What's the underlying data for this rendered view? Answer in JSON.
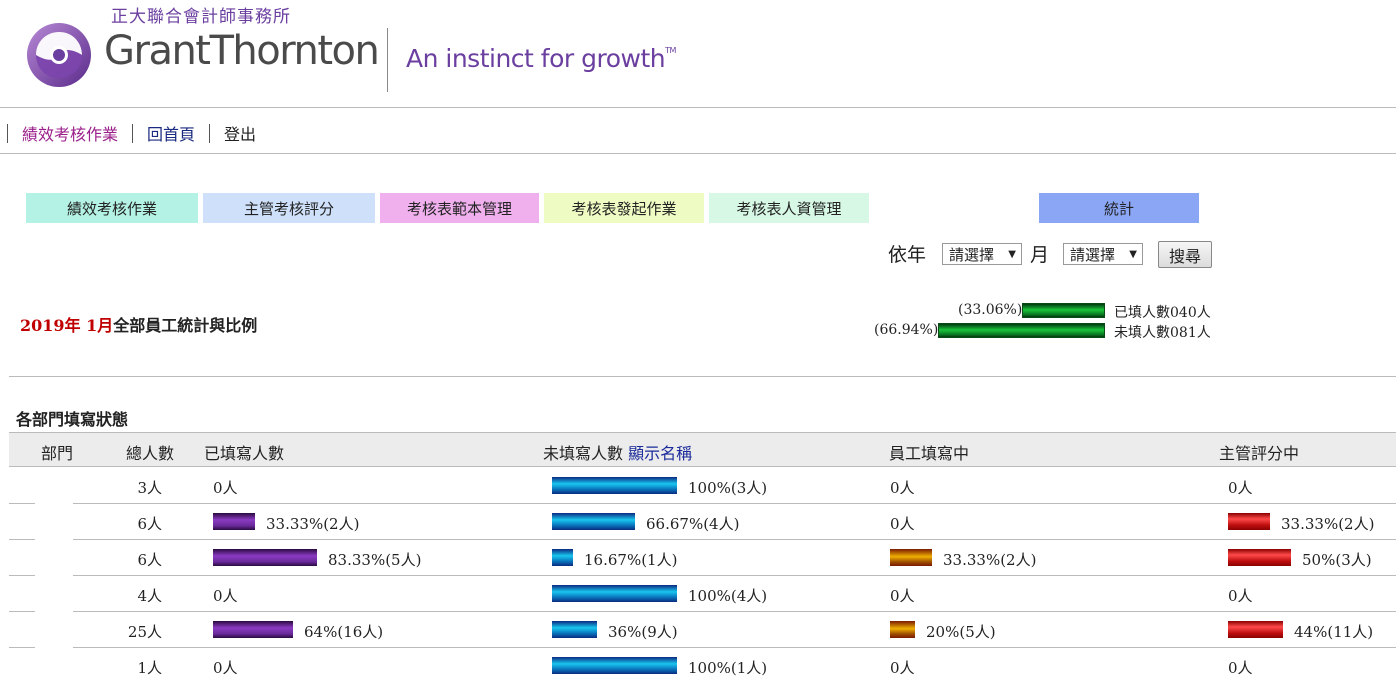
{
  "header": {
    "cn_firm": "正大聯合會計師事務所",
    "brand": "GrantThornton",
    "tagline": "An instinct for growth",
    "tm": "TM",
    "brand_color": "#6b3fa0"
  },
  "topnav": {
    "items": [
      {
        "label": "績效考核作業",
        "state": "active"
      },
      {
        "label": "回首頁",
        "state": "normal"
      },
      {
        "label": "登出",
        "state": "plain"
      }
    ]
  },
  "functions": [
    {
      "label": "績效考核作業",
      "color": "#b3f2e4"
    },
    {
      "label": "主管考核評分",
      "color": "#cfe0fa"
    },
    {
      "label": "考核表範本管理",
      "color": "#f0b0ee"
    },
    {
      "label": "考核表發起作業",
      "color": "#eefcc4"
    },
    {
      "label": "考核表人資管理",
      "color": "#d6f8e4"
    },
    {
      "label": "統計",
      "color": "#8aa6f5"
    }
  ],
  "filter": {
    "year_label": "依年",
    "year_value": "請選擇",
    "month_label": "月",
    "month_value": "請選擇",
    "search_label": "搜尋"
  },
  "summary": {
    "title_date": "2019年 1月",
    "title_rest": "全部員工統計與比例",
    "filled": {
      "pct": "(33.06%)",
      "label": "已填人數040人",
      "ratio": 0.3306
    },
    "unfilled": {
      "pct": "(66.94%)",
      "label": "未填人數081人",
      "ratio": 0.6694
    }
  },
  "dept": {
    "title": "各部門填寫狀態",
    "headers": {
      "dept": "部門",
      "total": "總人數",
      "filled": "已填寫人數",
      "unfilled": "未填寫人數",
      "show_names": "顯示名稱",
      "emp_filling": "員工填寫中",
      "mgr_scoring": "主管評分中"
    },
    "rows": [
      {
        "total": "3人",
        "filled": "0人",
        "filled_pct": 0,
        "unfilled": "100%(3人)",
        "unfilled_pct": 1.0,
        "emp": "0人",
        "emp_pct": 0,
        "mgr": "0人",
        "mgr_pct": 0
      },
      {
        "total": "6人",
        "filled": "33.33%(2人)",
        "filled_pct": 0.3333,
        "unfilled": "66.67%(4人)",
        "unfilled_pct": 0.6667,
        "emp": "0人",
        "emp_pct": 0,
        "mgr": "33.33%(2人)",
        "mgr_pct": 0.3333
      },
      {
        "total": "6人",
        "filled": "83.33%(5人)",
        "filled_pct": 0.8333,
        "unfilled": "16.67%(1人)",
        "unfilled_pct": 0.1667,
        "emp": "33.33%(2人)",
        "emp_pct": 0.3333,
        "mgr": "50%(3人)",
        "mgr_pct": 0.5
      },
      {
        "total": "4人",
        "filled": "0人",
        "filled_pct": 0,
        "unfilled": "100%(4人)",
        "unfilled_pct": 1.0,
        "emp": "0人",
        "emp_pct": 0,
        "mgr": "0人",
        "mgr_pct": 0
      },
      {
        "total": "25人",
        "filled": "64%(16人)",
        "filled_pct": 0.64,
        "unfilled": "36%(9人)",
        "unfilled_pct": 0.36,
        "emp": "20%(5人)",
        "emp_pct": 0.2,
        "mgr": "44%(11人)",
        "mgr_pct": 0.44
      },
      {
        "total": "1人",
        "filled": "0人",
        "filled_pct": 0,
        "unfilled": "100%(1人)",
        "unfilled_pct": 1.0,
        "emp": "0人",
        "emp_pct": 0,
        "mgr": "0人",
        "mgr_pct": 0
      }
    ]
  }
}
